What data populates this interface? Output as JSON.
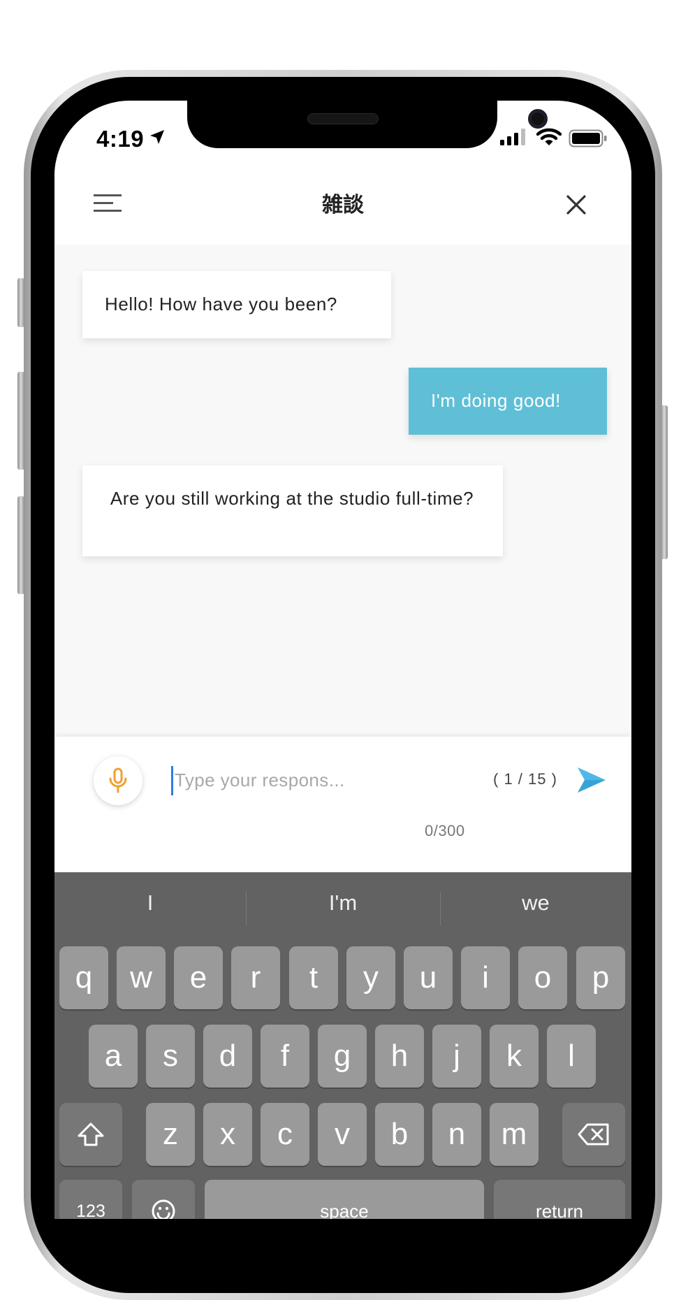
{
  "status_bar": {
    "time": "4:19"
  },
  "header": {
    "title": "雑談"
  },
  "messages": [
    {
      "from": "bot",
      "text": "Hello! How have you been?"
    },
    {
      "from": "user",
      "text": "I'm doing good!"
    },
    {
      "from": "bot",
      "text": " Are you still working at the studio full-time?"
    }
  ],
  "composer": {
    "placeholder": "Type your respons...",
    "value": "",
    "question_counter": "( 1 / 15 )",
    "char_count": "0/300"
  },
  "colors": {
    "accent": "#5fbfd6",
    "mic": "#f0a030",
    "send": "#4fb8e6"
  },
  "keyboard": {
    "suggestions": [
      "I",
      "I'm",
      "we"
    ],
    "row1": [
      "q",
      "w",
      "e",
      "r",
      "t",
      "y",
      "u",
      "i",
      "o",
      "p"
    ],
    "row2": [
      "a",
      "s",
      "d",
      "f",
      "g",
      "h",
      "j",
      "k",
      "l"
    ],
    "row3": [
      "z",
      "x",
      "c",
      "v",
      "b",
      "n",
      "m"
    ],
    "numbers_label": "123",
    "space_label": "space",
    "return_label": "return"
  },
  "icons": [
    "location-arrow-icon",
    "signal-icon",
    "wifi-icon",
    "battery-icon",
    "menu-icon",
    "close-icon",
    "microphone-icon",
    "send-icon",
    "shift-icon",
    "backspace-icon",
    "emoji-icon"
  ]
}
